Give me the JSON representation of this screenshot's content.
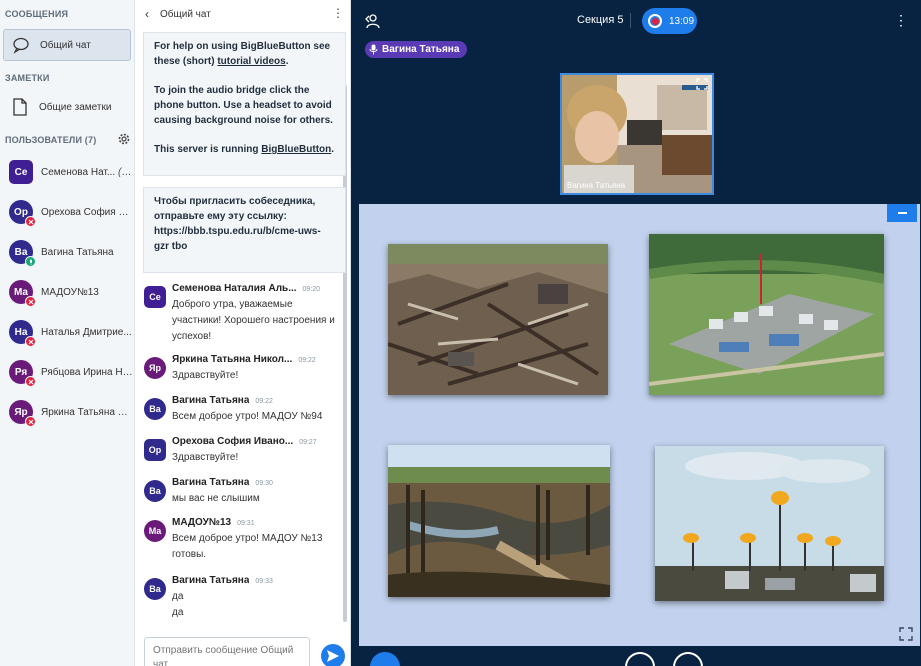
{
  "sidebar": {
    "messages_title": "СООБЩЕНИЯ",
    "public_chat": "Общий чат",
    "notes_title": "ЗАМЕТКИ",
    "shared_notes": "Общие заметки",
    "users_title": "ПОЛЬЗОВАТЕЛИ (7)",
    "users": [
      {
        "initials": "Се",
        "name": "Семенова Нат...",
        "suffix": "(Вы)",
        "color": "#3f1f93",
        "shape": "square",
        "mic": "none"
      },
      {
        "initials": "Ор",
        "name": "Орехова София И...",
        "suffix": "",
        "color": "#2f2a8c",
        "shape": "round",
        "mic": "muted"
      },
      {
        "initials": "Ва",
        "name": "Вагина Татьяна",
        "suffix": "",
        "color": "#2f2a8c",
        "shape": "round",
        "mic": "active"
      },
      {
        "initials": "Ма",
        "name": "МАДОУ№13",
        "suffix": "",
        "color": "#6a1b7a",
        "shape": "round",
        "mic": "muted"
      },
      {
        "initials": "На",
        "name": "Наталья Дмитрие...",
        "suffix": "",
        "color": "#2f2a8c",
        "shape": "round",
        "mic": "muted"
      },
      {
        "initials": "Ря",
        "name": "Рябцова Ирина Ни...",
        "suffix": "",
        "color": "#6a1b7a",
        "shape": "round",
        "mic": "muted"
      },
      {
        "initials": "Яр",
        "name": "Яркина Татьяна Ш...",
        "suffix": "",
        "color": "#6a1b7a",
        "shape": "round",
        "mic": "muted"
      }
    ]
  },
  "chat": {
    "title": "Общий чат",
    "welcome": {
      "help_pre": "For help on using BigBlueButton see these (short) ",
      "help_link": "tutorial videos",
      "help_post": ".",
      "audio": "To join the audio bridge click the phone button. Use a headset to avoid causing background noise for others.",
      "server_pre": "This server is running ",
      "server_link": "BigBlueButton",
      "server_post": "."
    },
    "invite": "Чтобы пригласить собеседника, отправьте ему эту ссылку: https://bbb.tspu.edu.ru/b/cme-uws-gzr tbo",
    "messages": [
      {
        "initials": "Се",
        "color": "#3f1f93",
        "shape": "square",
        "name": "Семенова Наталия Аль...",
        "time": "09:20",
        "text": "Доброго утра, уважаемые участники! Хорошего настроения и успехов!"
      },
      {
        "initials": "Яр",
        "color": "#6a1b7a",
        "shape": "round",
        "name": "Яркина Татьяна Никол...",
        "time": "09:22",
        "text": "Здравствуйте!"
      },
      {
        "initials": "Ва",
        "color": "#2f2a8c",
        "shape": "round",
        "name": "Вагина Татьяна",
        "time": "09:22",
        "text": "Всем доброе утро! МАДОУ №94"
      },
      {
        "initials": "Ор",
        "color": "#2f2a8c",
        "shape": "square",
        "name": "Орехова София Ивано...",
        "time": "09:27",
        "text": "Здравствуйте!"
      },
      {
        "initials": "Ва",
        "color": "#2f2a8c",
        "shape": "round",
        "name": "Вагина Татьяна",
        "time": "09:30",
        "text": "мы вас не слышим"
      },
      {
        "initials": "Ма",
        "color": "#6a1b7a",
        "shape": "round",
        "name": "МАДОУ№13",
        "time": "09:31",
        "text": "Всем доброе утро! МАДОУ №13 готовы."
      },
      {
        "initials": "Ва",
        "color": "#2f2a8c",
        "shape": "round",
        "name": "Вагина Татьяна",
        "time": "09:33",
        "text": "да\nда"
      }
    ],
    "composer_placeholder": "Отправить сообщение Общий чат"
  },
  "main": {
    "session": "Секция 5",
    "rec_time": "13:09",
    "talker": "Вагина Татьяна",
    "webcam_label": "Вагина Татьяна"
  },
  "colors": {
    "accent": "#1f7ceb",
    "dark_bg": "#082341",
    "muted": "#e0213f",
    "talking": "#5b3bb5",
    "mic_active": "#1aa67a"
  }
}
